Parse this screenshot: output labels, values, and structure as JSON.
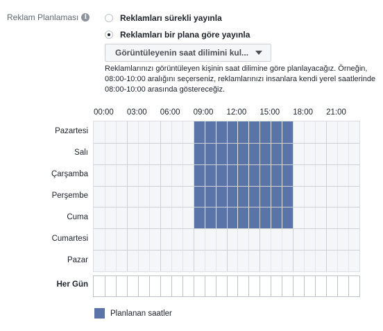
{
  "section": {
    "label": "Reklam Planlaması",
    "info_icon": "info-icon"
  },
  "options": [
    {
      "label": "Reklamları sürekli yayınla",
      "selected": false
    },
    {
      "label": "Reklamları bir plana göre yayınla",
      "selected": true
    }
  ],
  "timezone_dropdown": {
    "value": "Görüntüleyenin saat dilimini kul..."
  },
  "help_text": "Reklamlarınızı görüntüleyen kişinin saat dilimine göre planlayacağız. Örneğin, 08:00-10:00 aralığını seçerseniz, reklamlarınızı insanlara kendi yerel saatlerinde 08:00-10:00 arasında göstereceğiz.",
  "hour_labels": [
    "00:00",
    "03:00",
    "06:00",
    "09:00",
    "12:00",
    "15:00",
    "18:00",
    "21:00"
  ],
  "days": [
    "Pazartesi",
    "Salı",
    "Çarşamba",
    "Perşembe",
    "Cuma",
    "Cumartesi",
    "Pazar"
  ],
  "every_day_label": "Her Gün",
  "schedule": {
    "slots_per_day": 24,
    "selected": [
      {
        "day": "Pazartesi",
        "from_hour": 9,
        "to_hour": 18
      },
      {
        "day": "Salı",
        "from_hour": 9,
        "to_hour": 18
      },
      {
        "day": "Çarşamba",
        "from_hour": 9,
        "to_hour": 18
      },
      {
        "day": "Perşembe",
        "from_hour": 9,
        "to_hour": 18
      },
      {
        "day": "Cuma",
        "from_hour": 9,
        "to_hour": 18
      }
    ]
  },
  "legend": {
    "label": "Planlanan saatler",
    "color": "#5b74a8"
  },
  "colors": {
    "scheduled": "#5b74a8",
    "grid_bg": "#f5f6f7"
  }
}
